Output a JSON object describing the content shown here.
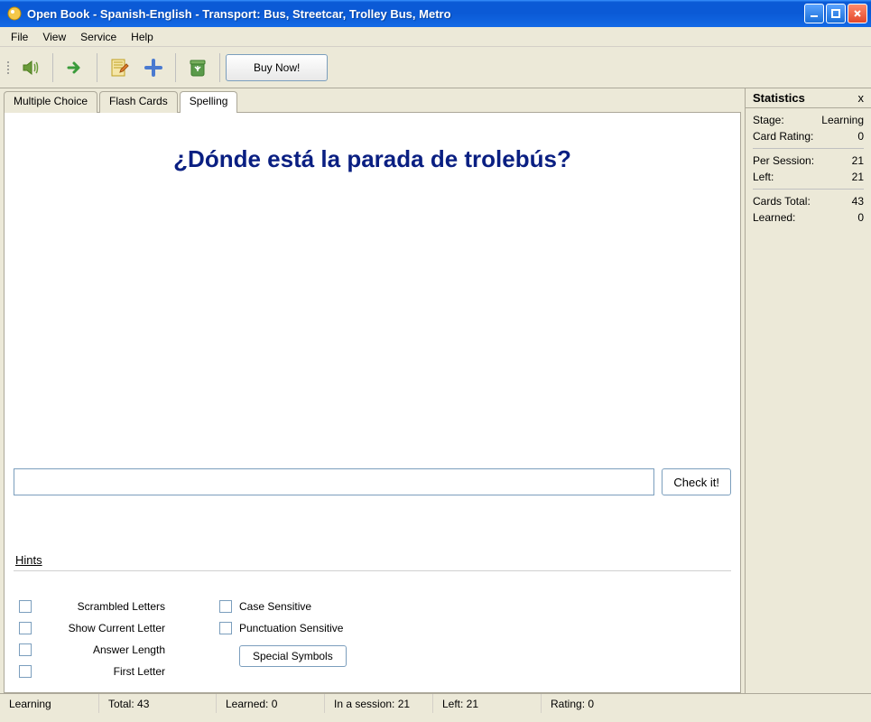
{
  "window": {
    "title": "Open Book - Spanish-English - Transport: Bus, Streetcar, Trolley Bus, Metro"
  },
  "menu": {
    "file": "File",
    "view": "View",
    "service": "Service",
    "help": "Help"
  },
  "toolbar": {
    "buy": "Buy Now!"
  },
  "tabs": {
    "multiple_choice": "Multiple Choice",
    "flash_cards": "Flash Cards",
    "spelling": "Spelling"
  },
  "question": "¿Dónde está la parada de trolebús?",
  "answer": {
    "value": "",
    "check": "Check it!"
  },
  "hints": {
    "title": "Hints",
    "scrambled": "Scrambled Letters",
    "show_current": "Show Current Letter",
    "answer_length": "Answer Length",
    "first_letter": "First Letter",
    "case_sensitive": "Case Sensitive",
    "punctuation_sensitive": "Punctuation Sensitive",
    "special_symbols": "Special Symbols"
  },
  "stats": {
    "title": "Statistics",
    "stage_label": "Stage:",
    "stage_value": "Learning",
    "rating_label": "Card Rating:",
    "rating_value": "0",
    "per_session_label": "Per Session:",
    "per_session_value": "21",
    "left_label": "Left:",
    "left_value": "21",
    "total_label": "Cards Total:",
    "total_value": "43",
    "learned_label": "Learned:",
    "learned_value": "0",
    "close": "x"
  },
  "status": {
    "stage": "Learning",
    "total": "Total: 43",
    "learned": "Learned: 0",
    "in_session": "In a session: 21",
    "left": "Left: 21",
    "rating": "Rating: 0"
  }
}
